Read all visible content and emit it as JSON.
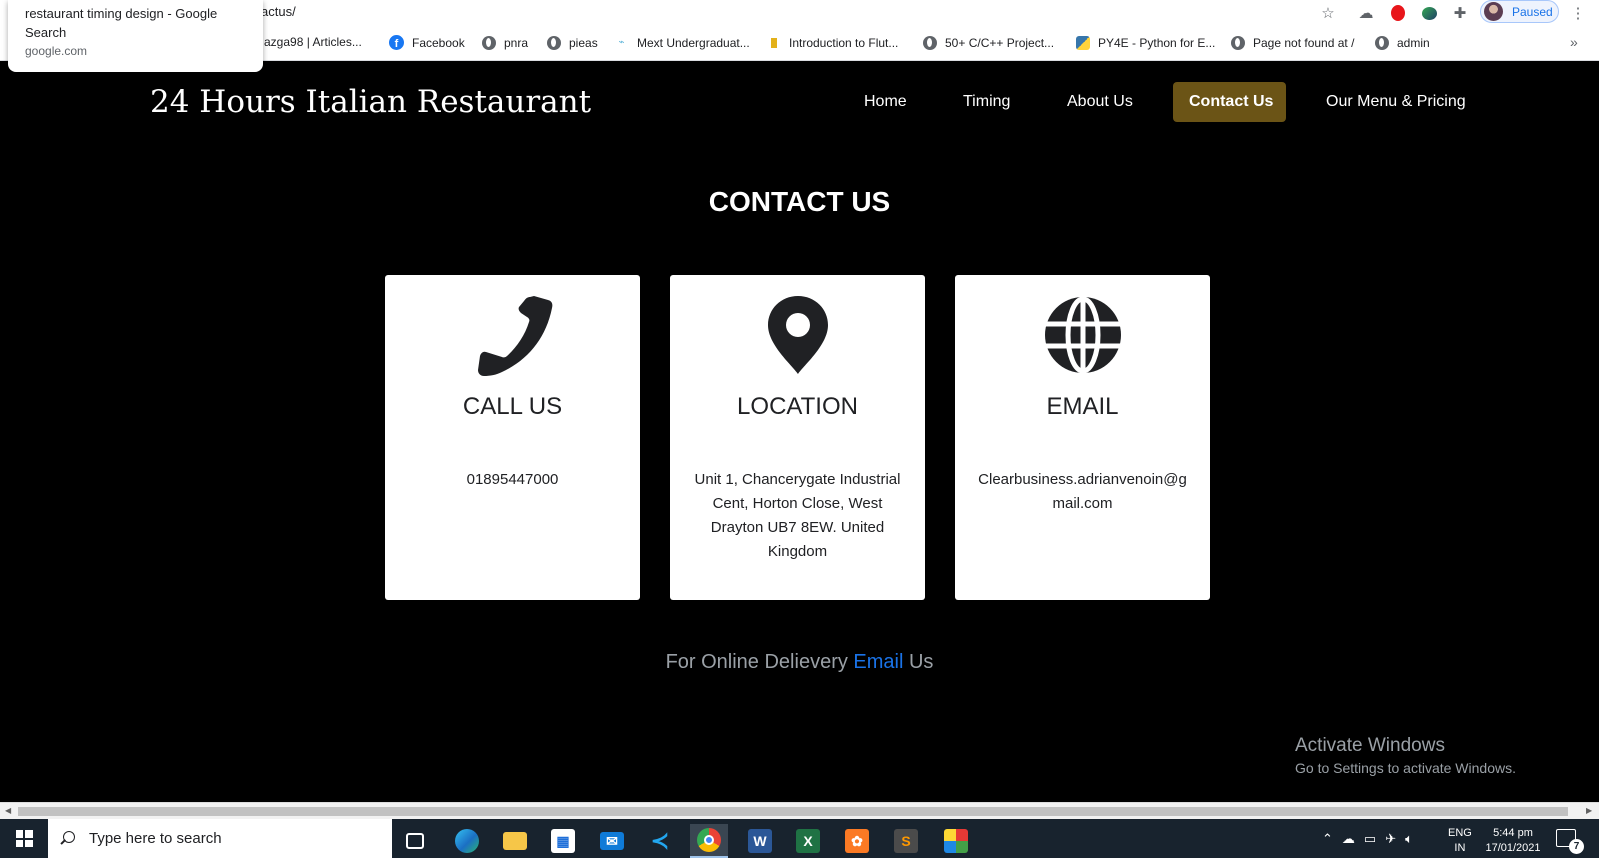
{
  "browser": {
    "url_fragment": "actus/",
    "tooltip": {
      "title": "restaurant timing design - Google Search",
      "domain": "google.com"
    },
    "profile_label": "Paused",
    "bookmarks": [
      {
        "label": "azga98 | Articles...",
        "icon": "none"
      },
      {
        "label": "Facebook",
        "icon": "facebook-icon"
      },
      {
        "label": "pnra",
        "icon": "globe-icon"
      },
      {
        "label": "pieas",
        "icon": "globe-icon"
      },
      {
        "label": "Mext Undergraduat...",
        "icon": "mext-icon"
      },
      {
        "label": "Introduction to Flut...",
        "icon": "flutter-icon"
      },
      {
        "label": "50+ C/C++ Project...",
        "icon": "globe-icon"
      },
      {
        "label": "PY4E - Python for E...",
        "icon": "python-icon"
      },
      {
        "label": "Page not found at /",
        "icon": "globe-icon"
      },
      {
        "label": "admin",
        "icon": "globe-icon"
      }
    ],
    "overflow": "»"
  },
  "site": {
    "brand": "24 Hours Italian Restaurant",
    "nav": [
      {
        "label": "Home",
        "active": false
      },
      {
        "label": "Timing",
        "active": false
      },
      {
        "label": "About Us",
        "active": false
      },
      {
        "label": "Contact Us",
        "active": true
      },
      {
        "label": "Our Menu & Pricing",
        "active": false
      }
    ],
    "active_color": "#6b5416",
    "page_title": "CONTACT US",
    "cards": [
      {
        "icon": "phone-icon",
        "heading": "CALL US",
        "body": "01895447000"
      },
      {
        "icon": "location-pin-icon",
        "heading": "LOCATION",
        "body": "Unit 1, Chancerygate Industrial Cent, Horton Close, West Drayton UB7 8EW. United Kingdom"
      },
      {
        "icon": "globe-icon",
        "heading": "EMAIL",
        "body": "Clearbusiness.adrianvenoin@gmail.com"
      }
    ],
    "delivery": {
      "prefix": "For Online Delievery ",
      "link": "Email",
      "suffix": " Us"
    },
    "link_color": "#1a73e8"
  },
  "windows": {
    "watermark_title": "Activate Windows",
    "watermark_sub": "Go to Settings to activate Windows.",
    "search_placeholder": "Type here to search",
    "apps": [
      "task-view-icon",
      "edge-icon",
      "file-explorer-icon",
      "store-icon",
      "mail-icon",
      "vscode-icon",
      "chrome-icon",
      "word-icon",
      "excel-icon",
      "xampp-icon",
      "sublime-icon",
      "app-icon"
    ],
    "lang_top": "ENG",
    "lang_bottom": "IN",
    "time": "5:44 pm",
    "date": "17/01/2021",
    "notification_count": "7"
  }
}
